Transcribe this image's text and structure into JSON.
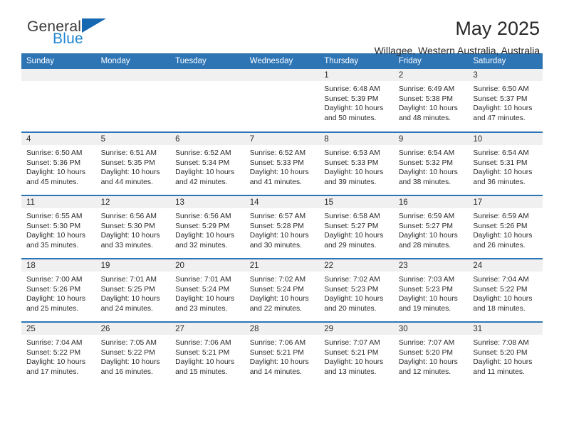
{
  "brand": {
    "word1": "General",
    "word2": "Blue",
    "logo_icon": "blue-triangle-logo",
    "accent_dark": "#1668b3",
    "accent_light": "#1f86d0"
  },
  "header": {
    "title": "May 2025",
    "location": "Willagee, Western Australia, Australia"
  },
  "colors": {
    "header_blue": "#2e75b6",
    "daynum_band": "#f0f0f0",
    "text": "#2a2a2a"
  },
  "weekday_headers": [
    "Sunday",
    "Monday",
    "Tuesday",
    "Wednesday",
    "Thursday",
    "Friday",
    "Saturday"
  ],
  "labels": {
    "sunrise_prefix": "Sunrise:",
    "sunset_prefix": "Sunset:",
    "daylight_prefix": "Daylight:"
  },
  "weeks": [
    [
      {
        "day": "",
        "line1": "",
        "line2": "",
        "line3": "",
        "line4": ""
      },
      {
        "day": "",
        "line1": "",
        "line2": "",
        "line3": "",
        "line4": ""
      },
      {
        "day": "",
        "line1": "",
        "line2": "",
        "line3": "",
        "line4": ""
      },
      {
        "day": "",
        "line1": "",
        "line2": "",
        "line3": "",
        "line4": ""
      },
      {
        "day": "1",
        "line1": "Sunrise: 6:48 AM",
        "line2": "Sunset: 5:39 PM",
        "line3": "Daylight: 10 hours",
        "line4": "and 50 minutes."
      },
      {
        "day": "2",
        "line1": "Sunrise: 6:49 AM",
        "line2": "Sunset: 5:38 PM",
        "line3": "Daylight: 10 hours",
        "line4": "and 48 minutes."
      },
      {
        "day": "3",
        "line1": "Sunrise: 6:50 AM",
        "line2": "Sunset: 5:37 PM",
        "line3": "Daylight: 10 hours",
        "line4": "and 47 minutes."
      }
    ],
    [
      {
        "day": "4",
        "line1": "Sunrise: 6:50 AM",
        "line2": "Sunset: 5:36 PM",
        "line3": "Daylight: 10 hours",
        "line4": "and 45 minutes."
      },
      {
        "day": "5",
        "line1": "Sunrise: 6:51 AM",
        "line2": "Sunset: 5:35 PM",
        "line3": "Daylight: 10 hours",
        "line4": "and 44 minutes."
      },
      {
        "day": "6",
        "line1": "Sunrise: 6:52 AM",
        "line2": "Sunset: 5:34 PM",
        "line3": "Daylight: 10 hours",
        "line4": "and 42 minutes."
      },
      {
        "day": "7",
        "line1": "Sunrise: 6:52 AM",
        "line2": "Sunset: 5:33 PM",
        "line3": "Daylight: 10 hours",
        "line4": "and 41 minutes."
      },
      {
        "day": "8",
        "line1": "Sunrise: 6:53 AM",
        "line2": "Sunset: 5:33 PM",
        "line3": "Daylight: 10 hours",
        "line4": "and 39 minutes."
      },
      {
        "day": "9",
        "line1": "Sunrise: 6:54 AM",
        "line2": "Sunset: 5:32 PM",
        "line3": "Daylight: 10 hours",
        "line4": "and 38 minutes."
      },
      {
        "day": "10",
        "line1": "Sunrise: 6:54 AM",
        "line2": "Sunset: 5:31 PM",
        "line3": "Daylight: 10 hours",
        "line4": "and 36 minutes."
      }
    ],
    [
      {
        "day": "11",
        "line1": "Sunrise: 6:55 AM",
        "line2": "Sunset: 5:30 PM",
        "line3": "Daylight: 10 hours",
        "line4": "and 35 minutes."
      },
      {
        "day": "12",
        "line1": "Sunrise: 6:56 AM",
        "line2": "Sunset: 5:30 PM",
        "line3": "Daylight: 10 hours",
        "line4": "and 33 minutes."
      },
      {
        "day": "13",
        "line1": "Sunrise: 6:56 AM",
        "line2": "Sunset: 5:29 PM",
        "line3": "Daylight: 10 hours",
        "line4": "and 32 minutes."
      },
      {
        "day": "14",
        "line1": "Sunrise: 6:57 AM",
        "line2": "Sunset: 5:28 PM",
        "line3": "Daylight: 10 hours",
        "line4": "and 30 minutes."
      },
      {
        "day": "15",
        "line1": "Sunrise: 6:58 AM",
        "line2": "Sunset: 5:27 PM",
        "line3": "Daylight: 10 hours",
        "line4": "and 29 minutes."
      },
      {
        "day": "16",
        "line1": "Sunrise: 6:59 AM",
        "line2": "Sunset: 5:27 PM",
        "line3": "Daylight: 10 hours",
        "line4": "and 28 minutes."
      },
      {
        "day": "17",
        "line1": "Sunrise: 6:59 AM",
        "line2": "Sunset: 5:26 PM",
        "line3": "Daylight: 10 hours",
        "line4": "and 26 minutes."
      }
    ],
    [
      {
        "day": "18",
        "line1": "Sunrise: 7:00 AM",
        "line2": "Sunset: 5:26 PM",
        "line3": "Daylight: 10 hours",
        "line4": "and 25 minutes."
      },
      {
        "day": "19",
        "line1": "Sunrise: 7:01 AM",
        "line2": "Sunset: 5:25 PM",
        "line3": "Daylight: 10 hours",
        "line4": "and 24 minutes."
      },
      {
        "day": "20",
        "line1": "Sunrise: 7:01 AM",
        "line2": "Sunset: 5:24 PM",
        "line3": "Daylight: 10 hours",
        "line4": "and 23 minutes."
      },
      {
        "day": "21",
        "line1": "Sunrise: 7:02 AM",
        "line2": "Sunset: 5:24 PM",
        "line3": "Daylight: 10 hours",
        "line4": "and 22 minutes."
      },
      {
        "day": "22",
        "line1": "Sunrise: 7:02 AM",
        "line2": "Sunset: 5:23 PM",
        "line3": "Daylight: 10 hours",
        "line4": "and 20 minutes."
      },
      {
        "day": "23",
        "line1": "Sunrise: 7:03 AM",
        "line2": "Sunset: 5:23 PM",
        "line3": "Daylight: 10 hours",
        "line4": "and 19 minutes."
      },
      {
        "day": "24",
        "line1": "Sunrise: 7:04 AM",
        "line2": "Sunset: 5:22 PM",
        "line3": "Daylight: 10 hours",
        "line4": "and 18 minutes."
      }
    ],
    [
      {
        "day": "25",
        "line1": "Sunrise: 7:04 AM",
        "line2": "Sunset: 5:22 PM",
        "line3": "Daylight: 10 hours",
        "line4": "and 17 minutes."
      },
      {
        "day": "26",
        "line1": "Sunrise: 7:05 AM",
        "line2": "Sunset: 5:22 PM",
        "line3": "Daylight: 10 hours",
        "line4": "and 16 minutes."
      },
      {
        "day": "27",
        "line1": "Sunrise: 7:06 AM",
        "line2": "Sunset: 5:21 PM",
        "line3": "Daylight: 10 hours",
        "line4": "and 15 minutes."
      },
      {
        "day": "28",
        "line1": "Sunrise: 7:06 AM",
        "line2": "Sunset: 5:21 PM",
        "line3": "Daylight: 10 hours",
        "line4": "and 14 minutes."
      },
      {
        "day": "29",
        "line1": "Sunrise: 7:07 AM",
        "line2": "Sunset: 5:21 PM",
        "line3": "Daylight: 10 hours",
        "line4": "and 13 minutes."
      },
      {
        "day": "30",
        "line1": "Sunrise: 7:07 AM",
        "line2": "Sunset: 5:20 PM",
        "line3": "Daylight: 10 hours",
        "line4": "and 12 minutes."
      },
      {
        "day": "31",
        "line1": "Sunrise: 7:08 AM",
        "line2": "Sunset: 5:20 PM",
        "line3": "Daylight: 10 hours",
        "line4": "and 11 minutes."
      }
    ]
  ]
}
